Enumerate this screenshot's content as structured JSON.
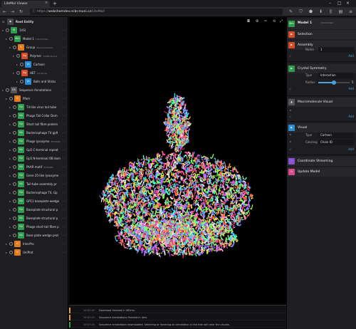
{
  "browser": {
    "tab_title": "LiteMol Viewer",
    "tab_close": "×",
    "new_tab": "+",
    "url_host": "webchemdev.ncbr.muni.cz",
    "url_path": "/LiteMol/",
    "url_prefix": "https://",
    "window_controls": {
      "minimize": "–",
      "maximize": "□",
      "close": "×"
    }
  },
  "tree": {
    "root_label": "Root Entity",
    "items": [
      {
        "label": "1VSI",
        "sub": "",
        "badge": "M",
        "color": "#2e9e4e"
      },
      {
        "label": "Model 1",
        "sub": "1VSI Protein",
        "badge": "Mm",
        "color": "#2e9e4e"
      },
      {
        "label": "Group",
        "sub": "Macromolecule",
        "badge": "G",
        "color": "#e07b1f"
      },
      {
        "label": "Polymer",
        "sub": "13980 atoms",
        "badge": "Sg",
        "color": "#d94c2a"
      },
      {
        "label": "Cartoon",
        "sub": "",
        "badge": "Vs",
        "color": "#2b8cd6"
      },
      {
        "label": "HET",
        "sub": "24 atoms",
        "badge": "Sg",
        "color": "#d94c2a"
      },
      {
        "label": "Balls and Sticks",
        "sub": "",
        "badge": "Vs",
        "color": "#2b8cd6"
      },
      {
        "label": "Sequence Annotations",
        "sub": "",
        "badge": "SA",
        "color": "#555"
      },
      {
        "label": "Pfam",
        "sub": "",
        "badge": "G",
        "color": "#e07b1f"
      },
      {
        "label": "T4-like virus tail tube",
        "sub": "",
        "badge": "SA",
        "color": "#2e9e4e"
      },
      {
        "label": "Phage Tail Collar Dom",
        "sub": "",
        "badge": "SA",
        "color": "#2e9e4e"
      },
      {
        "label": "Short tail fibre protein",
        "sub": "",
        "badge": "SA",
        "color": "#2e9e4e"
      },
      {
        "label": "Bacteriophage T4 gp9",
        "sub": "",
        "badge": "SA",
        "color": "#2e9e4e"
      },
      {
        "label": "Phage lysozyme",
        "sub": "PF00959",
        "badge": "SA",
        "color": "#2e9e4e"
      },
      {
        "label": "Gp5 C-terminal repeat",
        "sub": "",
        "badge": "SA",
        "color": "#2e9e4e"
      },
      {
        "label": "Gp5 N-terminal OB dom",
        "sub": "",
        "badge": "SA",
        "color": "#2e9e4e"
      },
      {
        "label": "PAAR motif",
        "sub": "PF05488",
        "badge": "SA",
        "color": "#2e9e4e"
      },
      {
        "label": "Gene 25-like lysozyme",
        "sub": "",
        "badge": "SA",
        "color": "#2e9e4e"
      },
      {
        "label": "Tail-tube assembly pr",
        "sub": "",
        "badge": "SA",
        "color": "#2e9e4e"
      },
      {
        "label": "Bacteriophage T4, Gp",
        "sub": "",
        "badge": "SA",
        "color": "#2e9e4e"
      },
      {
        "label": "GP11 baseplate wedge",
        "sub": "",
        "badge": "SA",
        "color": "#2e9e4e"
      },
      {
        "label": "Baseplate structural p",
        "sub": "",
        "badge": "SA",
        "color": "#2e9e4e"
      },
      {
        "label": "Baseplate structural p",
        "sub": "",
        "badge": "SA",
        "color": "#2e9e4e"
      },
      {
        "label": "Phage short tail fibre p",
        "sub": "",
        "badge": "SA",
        "color": "#2e9e4e"
      },
      {
        "label": "Base plate wedge prot",
        "sub": "",
        "badge": "SA",
        "color": "#2e9e4e"
      },
      {
        "label": "InterPro",
        "sub": "",
        "badge": "G",
        "color": "#e07b1f"
      },
      {
        "label": "UniProt",
        "sub": "",
        "badge": "G",
        "color": "#e07b1f"
      }
    ]
  },
  "log": [
    {
      "time": "10:07:19",
      "msg": "Download finished in 582ms.",
      "color": "#e0a030"
    },
    {
      "time": "10:07:19",
      "msg": "Sequence Annotations finished in 4ms.",
      "color": "#e0a030"
    },
    {
      "time": "10:07:19",
      "msg": "Sequence annotations downloaded. Selecting or hovering an annotation in the tree will color the visuals.",
      "color": "#2e9e4e"
    }
  ],
  "right": {
    "header_title": "Model 1",
    "header_sub": "1VSI Protein",
    "header_badge": "Mm",
    "selection_label": "Selection",
    "assembly_label": "Assembly",
    "assembly_name_label": "Name",
    "assembly_name_value": "1",
    "add_label": "Add",
    "crystal_label": "Crystal Symmetry",
    "crystal_type_label": "Type",
    "crystal_type_value": "Interaction",
    "crystal_radius_label": "Radius",
    "crystal_radius_value": "5",
    "crystal_radius_fraction": 0.5,
    "macro_visual_label": "Macromolecule Visual",
    "visual_label": "Visual",
    "visual_type_label": "Type",
    "visual_type_value": "Cartoon",
    "visual_coloring_label": "Coloring",
    "visual_coloring_value": "Chain ID",
    "coord_stream_label": "Coordinate Streaming",
    "update_model_label": "Update Model",
    "check_glyph": "✓",
    "expand_glyph": "▸",
    "collapse_glyph": "▾"
  }
}
